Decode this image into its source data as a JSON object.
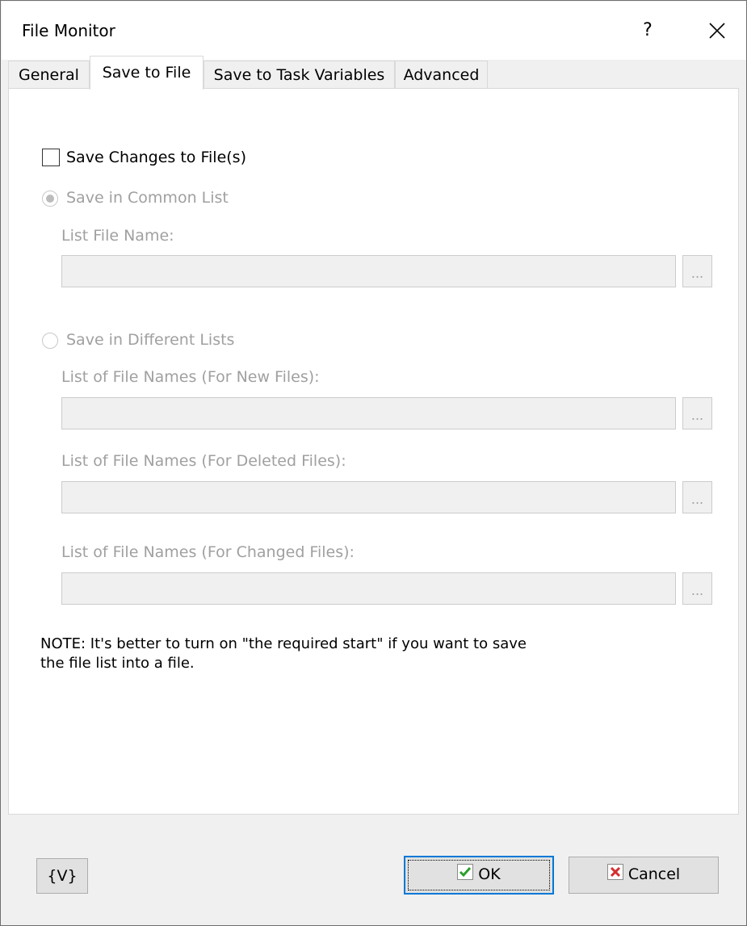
{
  "window": {
    "title": "File Monitor",
    "help_label": "?"
  },
  "tabs": [
    {
      "label": "General",
      "active": false
    },
    {
      "label": "Save to File",
      "active": true
    },
    {
      "label": "Save to Task Variables",
      "active": false
    },
    {
      "label": "Advanced",
      "active": false
    }
  ],
  "save_changes": {
    "label": "Save Changes to File(s)",
    "checked": false
  },
  "common_list": {
    "radio_label": "Save in Common List",
    "selected": true,
    "enabled": false,
    "file_label": "List File Name:",
    "file_value": "",
    "browse_label": "..."
  },
  "different_lists": {
    "radio_label": "Save in Different Lists",
    "selected": false,
    "enabled": false,
    "new_label": "List of File Names (For New Files):",
    "new_value": "",
    "deleted_label": "List of File Names (For Deleted Files):",
    "deleted_value": "",
    "changed_label": "List of File Names (For Changed Files):",
    "changed_value": "",
    "browse_label": "..."
  },
  "note": {
    "line1": "NOTE: It's better to turn on \"the required start\" if you want to save",
    "line2": "the file list into a file."
  },
  "buttons": {
    "variables": "{V}",
    "ok": "OK",
    "cancel": "Cancel"
  },
  "colors": {
    "accent": "#0078d7",
    "check_green": "#2e9e2e",
    "cancel_red": "#d32f2f",
    "disabled_text": "#a0a0a0"
  }
}
